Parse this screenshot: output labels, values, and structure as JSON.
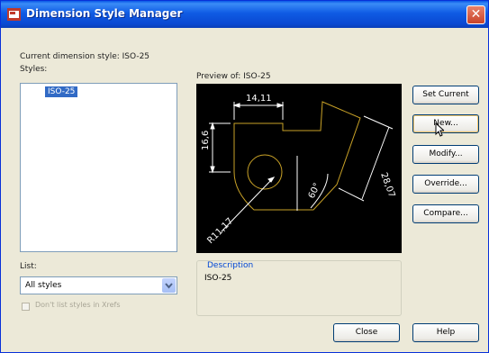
{
  "window": {
    "title": "Dimension Style Manager",
    "close_glyph": "✕"
  },
  "current_style": {
    "label": "Current dimension style: ISO-25"
  },
  "styles": {
    "label": "Styles:",
    "items": [
      "ISO-25"
    ]
  },
  "preview": {
    "label": "Preview of: ISO-25",
    "dimensions": [
      "14,11",
      "16,6",
      "28,07",
      "60°",
      "R11,17"
    ]
  },
  "buttons": {
    "set_current": "Set Current",
    "new": "New...",
    "modify": "Modify...",
    "override": "Override...",
    "compare": "Compare...",
    "close": "Close",
    "help": "Help"
  },
  "list": {
    "label": "List:",
    "selected": "All styles"
  },
  "xref_checkbox": {
    "label": "Don't list styles in Xrefs",
    "checked": false,
    "enabled": false
  },
  "description": {
    "title": "Description",
    "text": "ISO-25"
  },
  "colors": {
    "title_bar": "#0A58E6",
    "selection": "#316AC5",
    "preview_bg": "#000000",
    "drawing_lines": "#C9A227",
    "dimension_lines": "#FFFFFF"
  }
}
